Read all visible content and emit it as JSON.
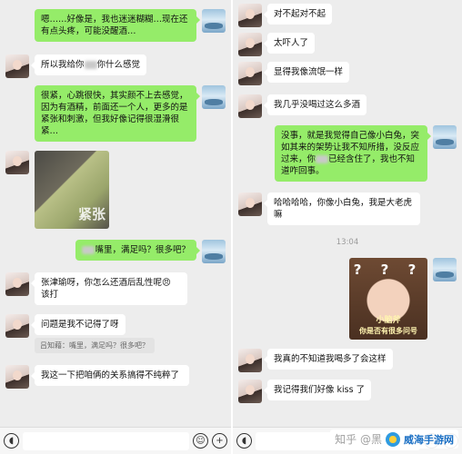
{
  "left_panel": {
    "messages": [
      {
        "text": "嗯……好像是，我也迷迷糊糊…现在还有点头疼，可能没醒酒…"
      },
      {
        "text_a": "所以我给你",
        "text_b": "你什么感觉"
      },
      {
        "text": "很紧，心跳很快，其实颜不上去感觉，因为有酒精，前面还一个人，更多的是紧张和刺激，但我好像记得很湿滑很紧…"
      },
      {
        "photo_caption": "紧张"
      },
      {
        "text": "嘴里，满足吗？很多吧？"
      },
      {
        "text": "张津瑜呀，你怎么还酒后乱性呢😠 该打"
      },
      {
        "text": "问题是我不记得了呀"
      },
      {
        "quote": "吕知藉：嘴里，满足吗？很多吧？"
      },
      {
        "text": "我这一下把咱俩的关系搞得不纯粹了"
      }
    ]
  },
  "right_panel": {
    "messages": [
      {
        "text": "对不起对不起"
      },
      {
        "text": "太吓人了"
      },
      {
        "text": "显得我像流氓一样"
      },
      {
        "text": "我几乎没喝过这么多酒"
      },
      {
        "text_a": "没事，就是我觉得自己像小白兔，突如其来的架势让我不知所措，没反应过来，你",
        "text_b": "已经含住了，我也不知道咋回事。"
      },
      {
        "text": "哈哈哈哈，你像小白兔，我是大老虎嘛"
      },
      {
        "sticker_marks": "? ? ?",
        "sticker_caption_1": "小脑斧",
        "sticker_caption_2": "你是否有很多问号"
      },
      {
        "text": "我真的不知道我喝多了会这样"
      },
      {
        "text": "我记得我们好像 kiss 了"
      }
    ],
    "timestamp": "13:04"
  },
  "input_bar": {
    "voice_icon": "voice-icon",
    "emoji_icon": "emoji-icon",
    "plus_icon": "plus-icon"
  },
  "watermark": {
    "text": "知乎 @黑",
    "site": "威海手游网"
  },
  "colors": {
    "chat_bg": "#ededed",
    "bubble_green": "#95ec69",
    "bubble_white": "#ffffff"
  }
}
